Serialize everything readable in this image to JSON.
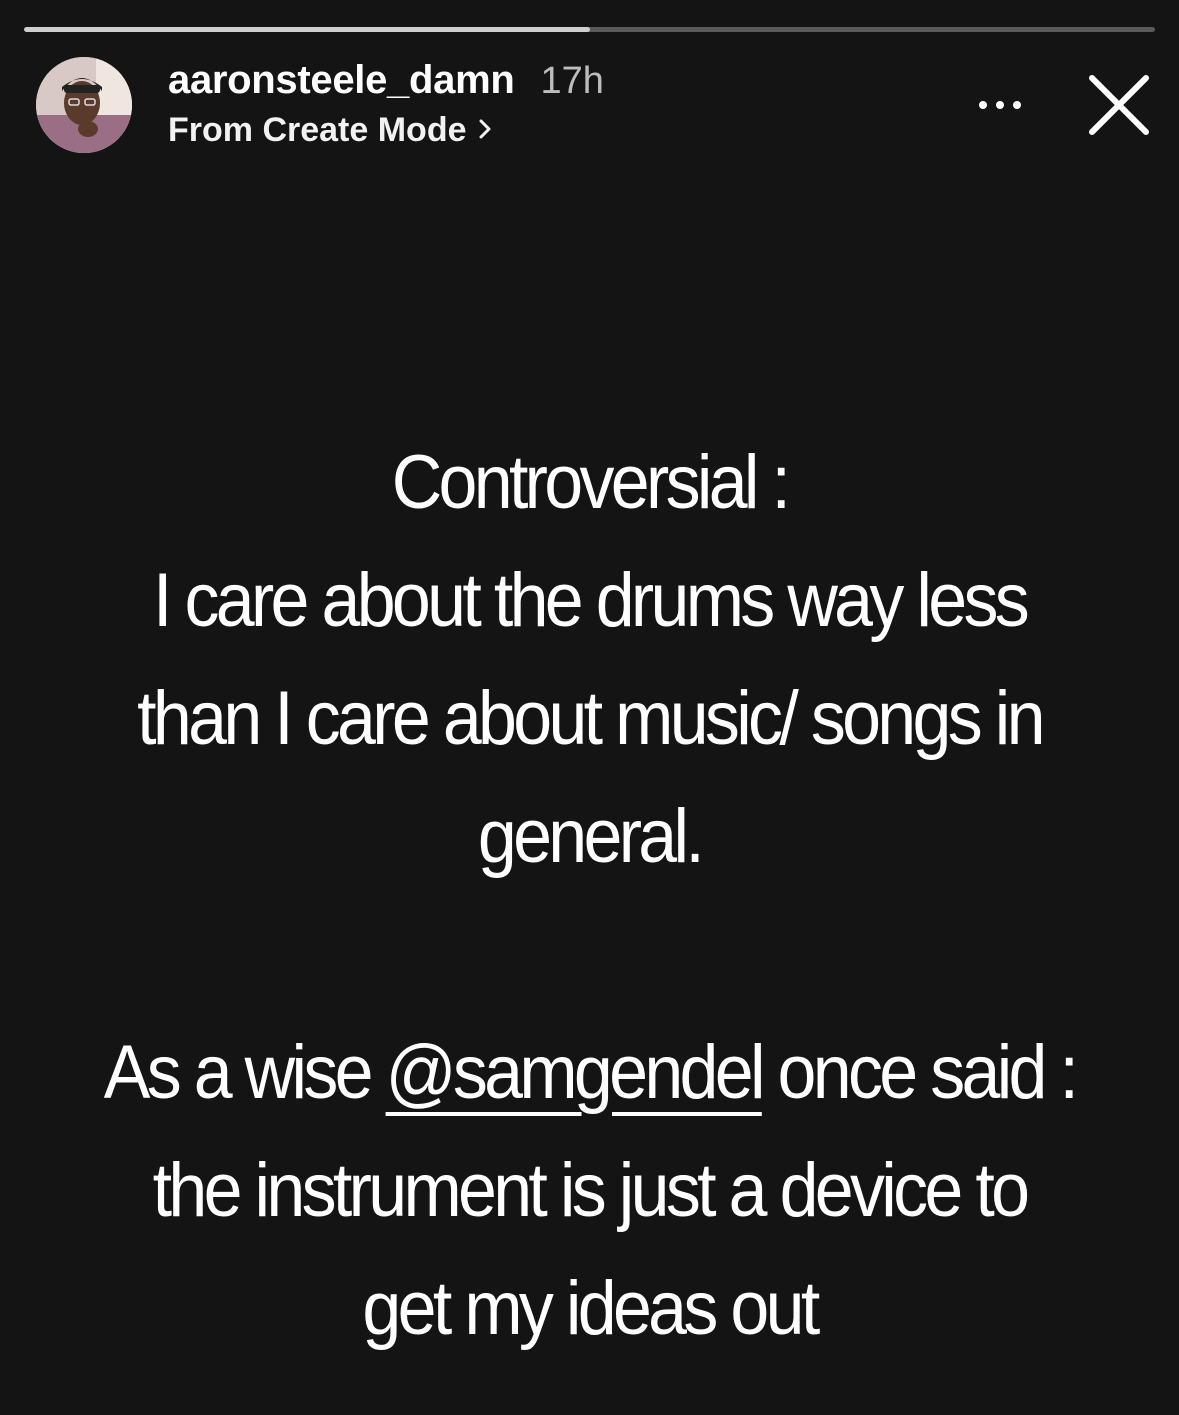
{
  "story": {
    "progress": 0.5
  },
  "header": {
    "username": "aaronsteele_damn",
    "timestamp": "17h",
    "subtitle": "From Create Mode",
    "subtitle_chevron": "chevron-right-icon",
    "more_icon": "more-icon",
    "close_icon": "close-icon"
  },
  "content": {
    "line1": "Controversial :",
    "line2": "I care about the drums way less",
    "line3": "than I care about music/ songs in",
    "line4": "general.",
    "line6_before": "As a wise ",
    "mention": "@samgendel",
    "line6_after": " once said :",
    "line7": "the instrument is just a device to",
    "line8": "get my ideas out"
  },
  "colors": {
    "background": "#141414",
    "text": "#ffffff",
    "timestamp": "#bdbdbd",
    "progress_track": "#5a5a5a",
    "progress_fill": "#cfcfcf"
  }
}
